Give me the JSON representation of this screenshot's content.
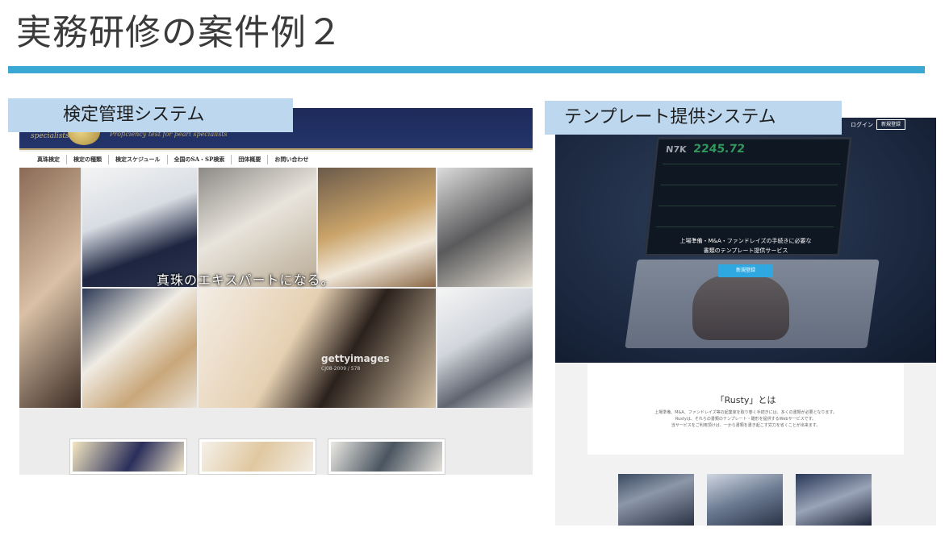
{
  "slide": {
    "title": "実務研修の案件例２",
    "accent_color": "#3aa8d3"
  },
  "left_panel": {
    "label": "検定管理システム",
    "site": {
      "logo_script": "specialists",
      "tagline": "Proficiency test for pearl specialists",
      "menu": [
        "真珠検定",
        "検定の種類",
        "検定スケジュール",
        "全国のSA・SP検索",
        "団体概要",
        "お問い合わせ"
      ],
      "hero_caption": "真珠のエキスパートになる。",
      "watermark": "gettyimages",
      "watermark_sub": "CJ08-2009 / 578"
    }
  },
  "right_panel": {
    "label": "テンプレート提供システム",
    "site": {
      "nav_login": "ログイン",
      "nav_signup": "新規登録",
      "ticker_code": "N7K",
      "ticker_value": "2245.72",
      "hero_line1": "上場準備・M&A・ファンドレイズの手続きに必要な",
      "hero_line2": "書類のテンプレート提供サービス",
      "hero_button": "新規登録",
      "about_title": "「Rusty」とは",
      "about_text_1": "上場準備、M&A、ファンドレイズ等の起業家を取り巻く手続きには、多くの書類が必要となります。",
      "about_text_2": "Rustyは、それらの書類のテンプレート・雛形を提供するWebサービスです。",
      "about_text_3": "当サービスをご利用頂けば、一から書類を書き起こす労力を省くことが出来ます。"
    }
  }
}
